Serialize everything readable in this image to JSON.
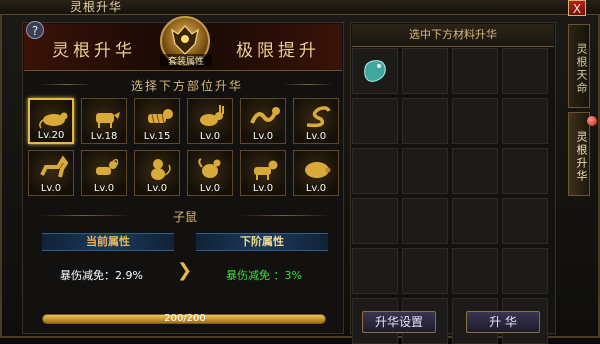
{
  "window": {
    "title": "灵根升华",
    "close_label": "X"
  },
  "help_label": "?",
  "banner": {
    "left_title": "灵根升华",
    "right_title": "极限提升",
    "emblem_label": "套装属性"
  },
  "parts_section": {
    "heading": "选择下方部位升华",
    "slots": [
      {
        "icon": "rat-icon",
        "level": "Lv.20",
        "selected": true
      },
      {
        "icon": "ox-icon",
        "level": "Lv.18"
      },
      {
        "icon": "tiger-icon",
        "level": "Lv.15"
      },
      {
        "icon": "rabbit-icon",
        "level": "Lv.0"
      },
      {
        "icon": "dragon-icon",
        "level": "Lv.0"
      },
      {
        "icon": "snake-icon",
        "level": "Lv.0"
      },
      {
        "icon": "horse-icon",
        "level": "Lv.0"
      },
      {
        "icon": "goat-icon",
        "level": "Lv.0"
      },
      {
        "icon": "monkey-icon",
        "level": "Lv.0"
      },
      {
        "icon": "rooster-icon",
        "level": "Lv.0"
      },
      {
        "icon": "dog-icon",
        "level": "Lv.0"
      },
      {
        "icon": "pig-icon",
        "level": "Lv.0"
      }
    ]
  },
  "selected_part": {
    "name": "子鼠"
  },
  "stats": {
    "current_title": "当前属性",
    "next_title": "下阶属性",
    "current_value": "暴伤减免：2.9%",
    "next_label": "暴伤减免 ：",
    "next_value": "3%"
  },
  "progress": {
    "text": "200/200",
    "fraction": 1.0
  },
  "materials": {
    "heading": "选中下方材料升华",
    "slots": [
      {
        "icon": "jade-material-icon",
        "filled": true
      },
      {},
      {},
      {},
      {},
      {},
      {},
      {},
      {},
      {},
      {},
      {},
      {},
      {},
      {},
      {},
      {},
      {},
      {},
      {},
      {},
      {},
      {},
      {}
    ]
  },
  "buttons": {
    "settings": "升华设置",
    "ascend": "升 华"
  },
  "side_tabs": [
    {
      "label": "灵根天命",
      "active": false
    },
    {
      "label": "灵根升华",
      "active": true
    }
  ],
  "colors": {
    "gold": "#e6b945",
    "current_stat": "#ffffff",
    "next_stat": "#3fdc3f",
    "current_title": "#e8b65c",
    "next_title": "#f0d98c"
  }
}
